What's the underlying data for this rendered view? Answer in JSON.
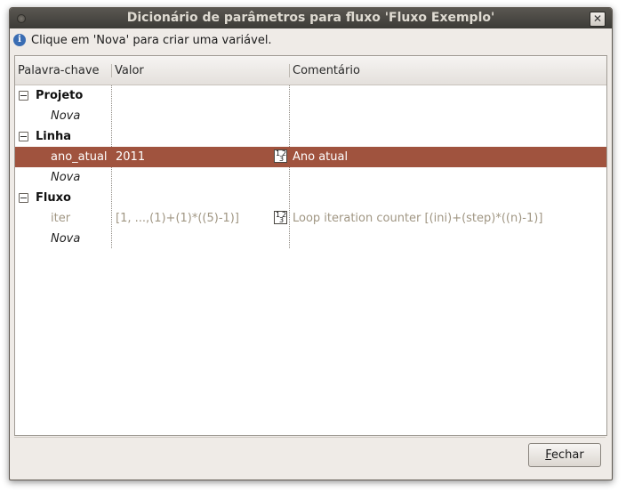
{
  "window": {
    "title": "Dicionário de parâmetros para fluxo 'Fluxo Exemplo'",
    "close_glyph": "✕"
  },
  "hint": {
    "icon": "info-icon",
    "text": "Clique em 'Nova' para criar uma variável."
  },
  "table": {
    "columns": [
      "Palavra-chave",
      "Valor",
      "Comentário"
    ],
    "groups": [
      {
        "name": "Projeto",
        "rows": [
          {
            "keyword": "Nova",
            "value": "",
            "comment": "",
            "kind": "new"
          }
        ]
      },
      {
        "name": "Linha",
        "rows": [
          {
            "keyword": "ano_atual",
            "value": "2011",
            "comment": "Ano atual",
            "kind": "selected",
            "type_icon": "numeric-type-icon"
          },
          {
            "keyword": "Nova",
            "value": "",
            "comment": "",
            "kind": "new"
          }
        ]
      },
      {
        "name": "Fluxo",
        "rows": [
          {
            "keyword": "iter",
            "value": "[1, ...,(1)+(1)*((5)-1)]",
            "comment": "Loop iteration counter [(ini)+(step)*((n)-1)]",
            "kind": "readonly",
            "type_icon": "numeric-type-icon"
          },
          {
            "keyword": "Nova",
            "value": "",
            "comment": "",
            "kind": "new"
          }
        ]
      }
    ]
  },
  "footer": {
    "close_button": "Fechar",
    "close_mnemonic": "F",
    "close_rest": "echar"
  },
  "colors": {
    "selection": "#a0533e",
    "titlebar": "#3c3b37",
    "muted_text": "#a09683"
  }
}
